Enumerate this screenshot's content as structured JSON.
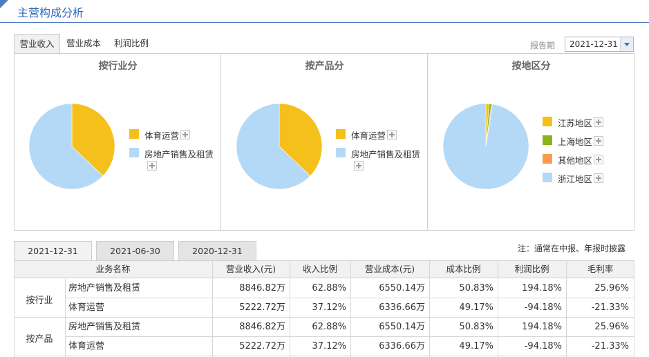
{
  "header": {
    "title": "主营构成分析"
  },
  "tabs": [
    {
      "label": "营业收入",
      "active": true
    },
    {
      "label": "营业成本",
      "active": false
    },
    {
      "label": "利润比例",
      "active": false
    }
  ],
  "report_period": {
    "label": "报告期",
    "value": "2021-12-31"
  },
  "colors": {
    "accent": "#2a66b6",
    "yellow": "#f5c01c",
    "light_blue": "#b3d9f7",
    "green": "#8db31c",
    "orange": "#fb9a50"
  },
  "icons": {
    "plus": "plus-icon",
    "dropdown": "chevron-down-icon"
  },
  "chart_data": [
    {
      "type": "pie",
      "title": "按行业分",
      "series": [
        {
          "name": "体育运营",
          "value": 37.12,
          "color": "#f5c01c"
        },
        {
          "name": "房地产销售及租赁",
          "value": 62.88,
          "color": "#b3d9f7"
        }
      ]
    },
    {
      "type": "pie",
      "title": "按产品分",
      "series": [
        {
          "name": "体育运营",
          "value": 37.12,
          "color": "#f5c01c"
        },
        {
          "name": "房地产销售及租赁",
          "value": 62.88,
          "color": "#b3d9f7"
        }
      ]
    },
    {
      "type": "pie",
      "title": "按地区分",
      "series": [
        {
          "name": "江苏地区",
          "value": 1.2,
          "color": "#f5c01c"
        },
        {
          "name": "上海地区",
          "value": 0.9,
          "color": "#8db31c"
        },
        {
          "name": "其他地区",
          "value": 0.4,
          "color": "#fb9a50"
        },
        {
          "name": "浙江地区",
          "value": 97.5,
          "color": "#b3d9f7"
        }
      ]
    }
  ],
  "period_tabs": [
    {
      "label": "2021-12-31",
      "active": true
    },
    {
      "label": "2021-06-30",
      "active": false
    },
    {
      "label": "2020-12-31",
      "active": false
    }
  ],
  "note": "注：通常在中报、年报时披露",
  "table": {
    "headers": [
      "业务名称",
      "营业收入(元)",
      "收入比例",
      "营业成本(元)",
      "成本比例",
      "利润比例",
      "毛利率"
    ],
    "groups": [
      {
        "label": "按行业",
        "rows": [
          [
            "房地产销售及租赁",
            "8846.82万",
            "62.88%",
            "6550.14万",
            "50.83%",
            "194.18%",
            "25.96%"
          ],
          [
            "体育运营",
            "5222.72万",
            "37.12%",
            "6336.66万",
            "49.17%",
            "-94.18%",
            "-21.33%"
          ]
        ]
      },
      {
        "label": "按产品",
        "rows": [
          [
            "房地产销售及租赁",
            "8846.82万",
            "62.88%",
            "6550.14万",
            "50.83%",
            "194.18%",
            "25.96%"
          ],
          [
            "体育运营",
            "5222.72万",
            "37.12%",
            "6336.66万",
            "49.17%",
            "-94.18%",
            "-21.33%"
          ]
        ]
      }
    ]
  }
}
